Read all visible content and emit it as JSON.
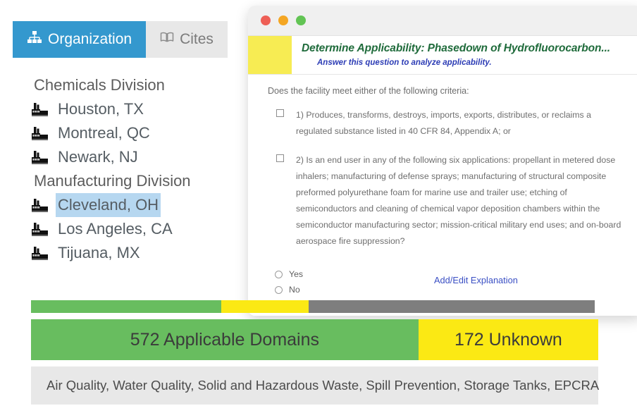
{
  "tabs": [
    {
      "label": "Organization",
      "icon": "sitemap-icon",
      "active": true
    },
    {
      "label": "Cites",
      "icon": "book-icon",
      "active": false
    }
  ],
  "tree": [
    {
      "type": "group",
      "label": "Chemicals Division"
    },
    {
      "type": "facility",
      "label": "Houston, TX",
      "selected": false
    },
    {
      "type": "facility",
      "label": "Montreal, QC",
      "selected": false
    },
    {
      "type": "facility",
      "label": "Newark, NJ",
      "selected": false
    },
    {
      "type": "group",
      "label": "Manufacturing Division"
    },
    {
      "type": "facility",
      "label": "Cleveland, OH",
      "selected": true
    },
    {
      "type": "facility",
      "label": "Los Angeles, CA",
      "selected": false
    },
    {
      "type": "facility",
      "label": "Tijuana, MX",
      "selected": false
    }
  ],
  "dialog": {
    "title": "Determine Applicability: Phasedown of Hydrofluorocarbon...",
    "subtitle": "Answer this question to analyze applicability.",
    "swatch_color": "#f7ec53",
    "question_lead": "Does the facility meet either of the following criteria:",
    "criteria": [
      "1) Produces, transforms, destroys, imports, exports, distributes, or reclaims a regulated substance listed in 40 CFR 84, Appendix A; or",
      "2) Is an end user in any of the following six applications: propellant in metered dose inhalers; manufacturing of defense sprays; manufacturing of structural composite preformed polyurethane foam for marine use and trailer use; etching of semiconductors and cleaning of chemical vapor deposition chambers within the semiconductor manufacturing sector; mission-critical military end uses; and on-board aerospace fire suppression?"
    ],
    "answers": [
      {
        "label": "Yes",
        "selected": false
      },
      {
        "label": "No",
        "selected": false
      }
    ],
    "explanation_link": "Add/Edit Explanation",
    "window_dots": [
      {
        "name": "close-dot",
        "color": "#ee5f56"
      },
      {
        "name": "minimize-dot",
        "color": "#f4a623"
      },
      {
        "name": "maximize-dot",
        "color": "#62c454"
      }
    ]
  },
  "status_bar": {
    "segments": [
      {
        "name": "applicable",
        "percent": 33.7,
        "color": "#68bd5f"
      },
      {
        "name": "unknown",
        "percent": 15.5,
        "color": "#fbe914"
      },
      {
        "name": "not-applicable",
        "percent": 50.8,
        "color": "#7e7e7e"
      }
    ]
  },
  "summary": {
    "applicable_label": "572  Applicable Domains",
    "unknown_label": "172 Unknown",
    "applicable_color": "#68bd5f",
    "unknown_color": "#fbe914"
  },
  "domains_footer": "Air Quality, Water Quality, Solid and Hazardous Waste, Spill Prevention, Storage Tanks, EPCRA"
}
